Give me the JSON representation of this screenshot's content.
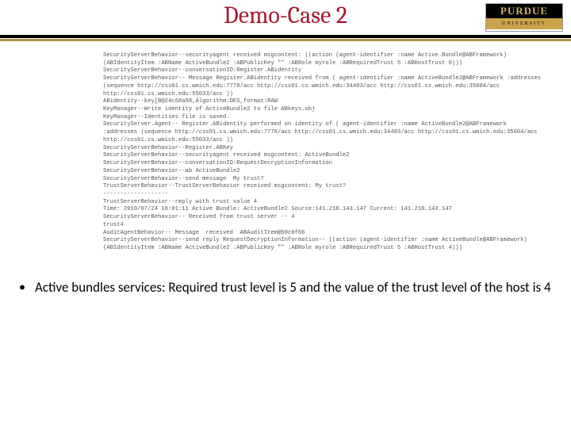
{
  "title": "Demo-Case 2",
  "logo": {
    "top": "PURDUE",
    "bot": "UNIVERSITY"
  },
  "log_lines": [
    "SecurityServerBehavior--securityagent received msgcontent: ((action (agent-identifier :name Active.Bundle@ABFramework) (ABIdentityItem :ABName ActiveBundle2 :ABPublicKey \"\" :ABRole myrole :ABRequiredTrust 5 :ABHostTrust 0)))",
    "SecurityServerBehavior--conversationID:Register.ABidentity",
    "SecurityServerBehavior-- Message Register.ABidentity received from ( agent-identifier :name ActiveBundle2@ABFramework :addresses (sequence http://css01.cs.wmich.edu:7778/acc http://css01.cs.wmich.edu:34403/acc http://css01.cs.wmich.edu:35004/acc http://css01.cs.wmich.edu:55033/acc ))",
    "ABidentity--key[B@24c68a98,Algorithm:DES,format:RAW",
    "KeyManager--Write identity of ActiveBundle2 to file ABkeys.obj",
    "KeyManager--Identities file is saved.",
    "SecurityServer.Agent-- Register.ABidentity performed on identity of ( agent-identifier :name ActiveBundle2@ABFramework :addresses (sequence http://css01.cs.wmich.edu:7778/acc http://css01.cs.wmich.edu:34403/acc http://css01.cs.wmich.edu:35004/acc http://css01.cs.wmich.edu:55033/acc ))",
    "SecurityServerBehavior--Register.ABKey",
    "SecurityServerBehavior--securityagent received msgcontent: ActiveBundle2",
    "SecurityServerBehavior--conversationID:RequestDecryptionInformation",
    "SecurityServerBehavior--ab ActiveBundle2",
    "SecurityServerBehavior--send message  My trust?",
    "TrustServerBehavior--TrustServerBehavior received msgcontent: My trust?",
    "-------------------",
    "TrustServerBehavior--reply with trust value 4",
    "Time: 2010/07/24 18:01:11 Active Bundle: ActiveBundle2 Source:141.218.143.147 Current: 141.218.143.147",
    "SecurityServerBehavior-- Received from trust server -- 4",
    "trust4",
    "AuditAgentBehavior-- Message  received  ABAuditItem@b0c0f66",
    "SecurityServerBehavior--send reply RequestDecryptionInformation-- ((action (agent-identifier :name ActiveBundle@ABFramework) (ABIdentityItem :ABName ActiveBundle2 :ABPublicKey \"\" :ABRole myrole :ABRequiredTrust 5 :ABHostTrust 4)))"
  ],
  "bullet": "Active bundles services: Required trust level is 5 and the value of the trust level of the host is 4"
}
